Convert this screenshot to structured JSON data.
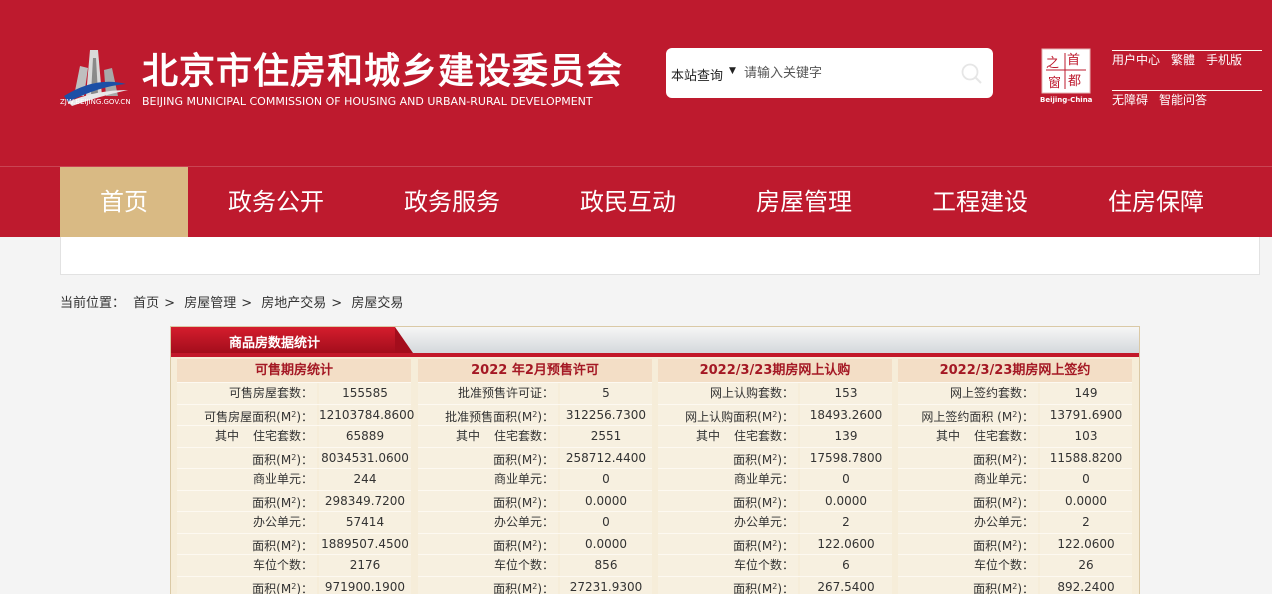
{
  "header": {
    "site_title": "北京市住房和城乡建设委员会",
    "site_subtitle": "BEIJING MUNICIPAL COMMISSION OF HOUSING AND URBAN-RURAL DEVELOPMENT",
    "logo_url_text": "ZJW.BEIJING.GOV.CN",
    "search": {
      "scope": "本站查询",
      "placeholder": "请输入关键字"
    },
    "capital_caption": "Beijing-China",
    "links_row1": [
      "用户中心",
      "繁體",
      "手机版"
    ],
    "links_row2": [
      "无障碍",
      "智能问答"
    ],
    "colors": {
      "brand_red": "#be1a2e",
      "nav_active": "#d9ba84"
    }
  },
  "nav": {
    "items": [
      "首页",
      "政务公开",
      "政务服务",
      "政民互动",
      "房屋管理",
      "工程建设",
      "住房保障"
    ],
    "active_index": 0
  },
  "breadcrumb": {
    "prefix": "当前位置：",
    "items": [
      "首页",
      "房屋管理",
      "房地产交易",
      "房屋交易"
    ],
    "separator": ">"
  },
  "stats_panel": {
    "title": "商品房数据统计",
    "columns": [
      {
        "header": "可售期房统计",
        "rows": [
          {
            "label": "可售房屋套数：",
            "value": "155585"
          },
          {
            "label": "可售房屋面积(M",
            "sup": "2",
            "label_tail": ")：",
            "value": "12103784.8600"
          },
          {
            "prefix": "其中",
            "label": "住宅套数：",
            "value": "65889"
          },
          {
            "label": "面积(M",
            "sup": "2",
            "label_tail": ")：",
            "value": "8034531.0600"
          },
          {
            "label": "商业单元：",
            "value": "244"
          },
          {
            "label": "面积(M",
            "sup": "2",
            "label_tail": ")：",
            "value": "298349.7200"
          },
          {
            "label": "办公单元：",
            "value": "57414"
          },
          {
            "label": "面积(M",
            "sup": "2",
            "label_tail": ")：",
            "value": "1889507.4500"
          },
          {
            "label": "车位个数：",
            "value": "2176"
          },
          {
            "label": "面积(M",
            "sup": "2",
            "label_tail": ")：",
            "value": "971900.1900"
          }
        ]
      },
      {
        "header": "2022 年2月预售许可",
        "rows": [
          {
            "label": "批准预售许可证：",
            "value": "5"
          },
          {
            "label": "批准预售面积(M",
            "sup": "2",
            "label_tail": ")：",
            "value": "312256.7300"
          },
          {
            "prefix": "其中",
            "label": "住宅套数：",
            "value": "2551"
          },
          {
            "label": "面积(M",
            "sup": "2",
            "label_tail": ")：",
            "value": "258712.4400"
          },
          {
            "label": "商业单元：",
            "value": "0"
          },
          {
            "label": "面积(M",
            "sup": "2",
            "label_tail": ")：",
            "value": "0.0000"
          },
          {
            "label": "办公单元：",
            "value": "0"
          },
          {
            "label": "面积(M",
            "sup": "2",
            "label_tail": ")：",
            "value": "0.0000"
          },
          {
            "label": "车位个数：",
            "value": "856"
          },
          {
            "label": "面积(M",
            "sup": "2",
            "label_tail": ")：",
            "value": "27231.9300"
          }
        ]
      },
      {
        "header": "2022/3/23期房网上认购",
        "rows": [
          {
            "label": "网上认购套数：",
            "value": "153"
          },
          {
            "label": "网上认购面积(M",
            "sup": "2",
            "label_tail": ")：",
            "value": "18493.2600"
          },
          {
            "prefix": "其中",
            "label": "住宅套数：",
            "value": "139"
          },
          {
            "label": "面积(M",
            "sup": "2",
            "label_tail": ")：",
            "value": "17598.7800"
          },
          {
            "label": "商业单元：",
            "value": "0"
          },
          {
            "label": "面积(M",
            "sup": "2",
            "label_tail": ")：",
            "value": "0.0000"
          },
          {
            "label": "办公单元：",
            "value": "2"
          },
          {
            "label": "面积(M",
            "sup": "2",
            "label_tail": ")：",
            "value": "122.0600"
          },
          {
            "label": "车位个数：",
            "value": "6"
          },
          {
            "label": "面积(M",
            "sup": "2",
            "label_tail": ")：",
            "value": "267.5400"
          }
        ]
      },
      {
        "header": "2022/3/23期房网上签约",
        "rows": [
          {
            "label": "网上签约套数：",
            "value": "149"
          },
          {
            "label": "网上签约面积 (M",
            "sup": "2",
            "label_tail": ")：",
            "value": "13791.6900"
          },
          {
            "prefix": "其中",
            "label": "住宅套数：",
            "value": "103"
          },
          {
            "label": "面积(M",
            "sup": "2",
            "label_tail": ")：",
            "value": "11588.8200"
          },
          {
            "label": "商业单元：",
            "value": "0"
          },
          {
            "label": "面积(M",
            "sup": "2",
            "label_tail": ")：",
            "value": "0.0000"
          },
          {
            "label": "办公单元：",
            "value": "2"
          },
          {
            "label": "面积(M",
            "sup": "2",
            "label_tail": ")：",
            "value": "122.0600"
          },
          {
            "label": "车位个数：",
            "value": "26"
          },
          {
            "label": "面积(M",
            "sup": "2",
            "label_tail": ")：",
            "value": "892.2400"
          }
        ]
      }
    ]
  }
}
